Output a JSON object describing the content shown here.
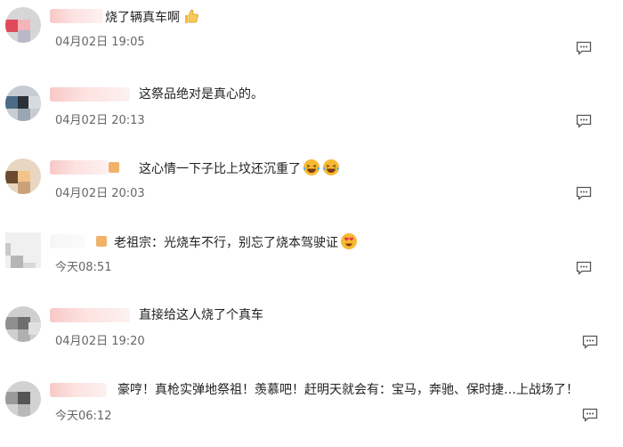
{
  "comments": [
    {
      "text": "烧了辆真车啊",
      "time": "04月02日 19:05",
      "emojis": [
        "thumbs-up-icon"
      ]
    },
    {
      "text": "这祭品绝对是真心的。",
      "time": "04月02日 20:13",
      "emojis": []
    },
    {
      "text": "这心情一下子比上坟还沉重了",
      "time": "04月02日 20:03",
      "emojis": [
        "laughing-tears-icon",
        "laughing-tears-icon"
      ]
    },
    {
      "text": "老祖宗：光烧车不行，别忘了烧本驾驶证",
      "time": "今天08:51",
      "emojis": [
        "heart-eyes-icon"
      ]
    },
    {
      "text": "直接给这人烧了个真车",
      "time": "04月02日 19:20",
      "emojis": []
    },
    {
      "text": "豪哼！真枪实弹地祭祖！羡慕吧！赶明天就会有：宝马，奔驰、保时捷…上战场了！",
      "time": "今天06:12",
      "emojis": []
    }
  ],
  "colors": {
    "text": "#222222",
    "time": "#666666",
    "icon": "#555555",
    "emoji": "#f6b932"
  }
}
